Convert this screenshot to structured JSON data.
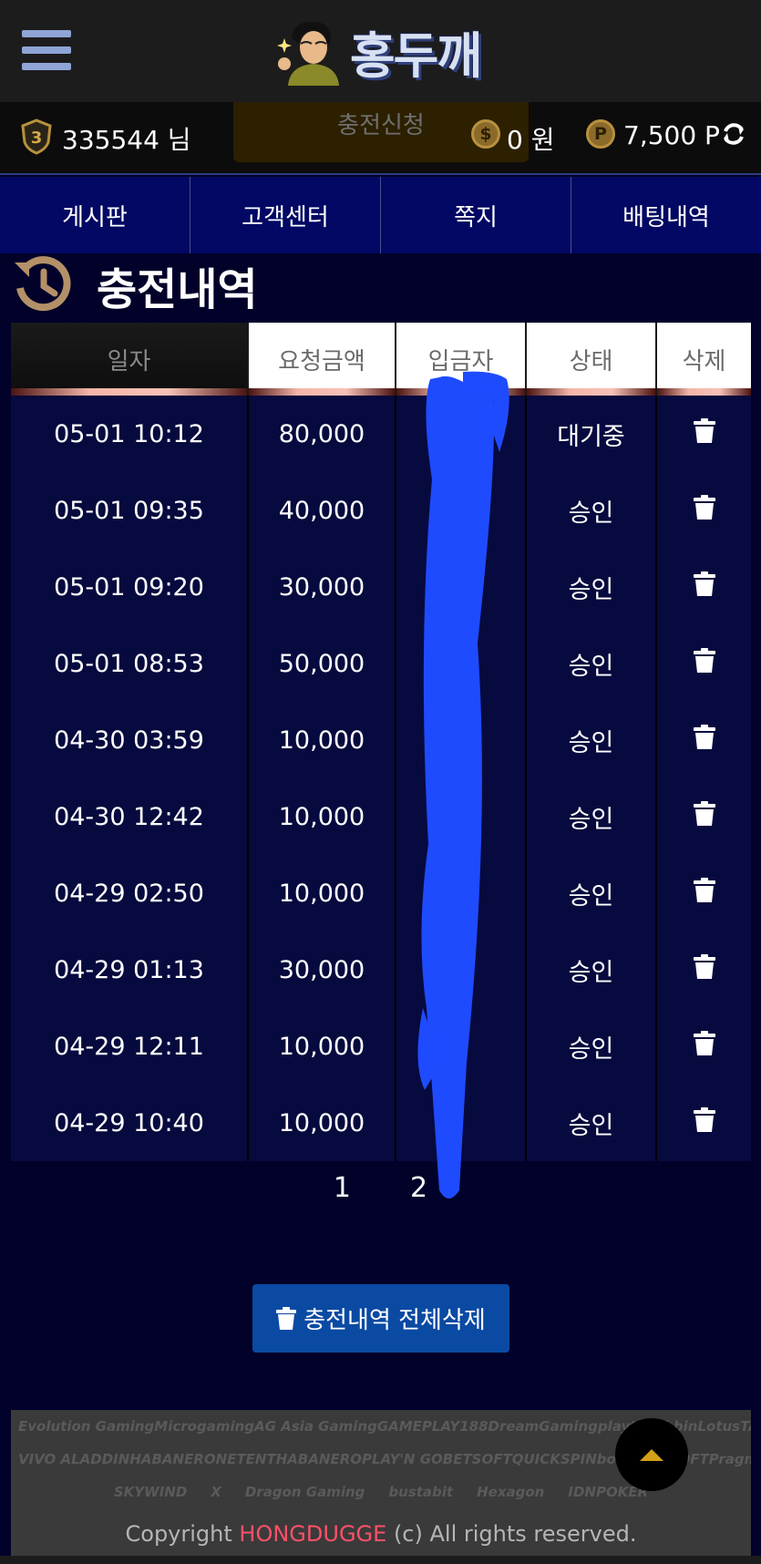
{
  "header": {
    "logo_text": "홍두깨"
  },
  "userbar": {
    "level": "3",
    "username": "335544 님",
    "charge_button": "충전신청",
    "money_symbol": "$",
    "money": "0 원",
    "point_symbol": "P",
    "points": "7,500 P"
  },
  "nav": [
    {
      "label": "게시판"
    },
    {
      "label": "고객센터"
    },
    {
      "label": "쪽지"
    },
    {
      "label": "배팅내역"
    }
  ],
  "page": {
    "title": "충전내역"
  },
  "table": {
    "headers": [
      "일자",
      "요청금액",
      "입금자",
      "상태",
      "삭제"
    ],
    "rows": [
      {
        "date": "05-01 10:12",
        "amount": "80,000",
        "depositor": "",
        "status": "대기중"
      },
      {
        "date": "05-01 09:35",
        "amount": "40,000",
        "depositor": "",
        "status": "승인"
      },
      {
        "date": "05-01 09:20",
        "amount": "30,000",
        "depositor": "",
        "status": "승인"
      },
      {
        "date": "05-01 08:53",
        "amount": "50,000",
        "depositor": "",
        "status": "승인"
      },
      {
        "date": "04-30 03:59",
        "amount": "10,000",
        "depositor": "",
        "status": "승인"
      },
      {
        "date": "04-30 12:42",
        "amount": "10,000",
        "depositor": "",
        "status": "승인"
      },
      {
        "date": "04-29 02:50",
        "amount": "10,000",
        "depositor": "",
        "status": "승인"
      },
      {
        "date": "04-29 01:13",
        "amount": "30,000",
        "depositor": "",
        "status": "승인"
      },
      {
        "date": "04-29 12:11",
        "amount": "10,000",
        "depositor": "",
        "status": "승인"
      },
      {
        "date": "04-29 10:40",
        "amount": "10,000",
        "depositor": "",
        "status": "승인"
      }
    ]
  },
  "pagination": {
    "pages": [
      "1",
      "2"
    ]
  },
  "delete_all_label": "충전내역 전체삭제",
  "footer": {
    "providers_row1": [
      "Evolution Gaming",
      "Microgaming",
      "AG Asia Gaming",
      "GAMEPLAY",
      "188",
      "DreamGaming",
      "playtech",
      "bbin",
      "Lotus",
      "TAISHAN"
    ],
    "providers_row2": [
      "VIVO ALADDIN",
      "HABANERO",
      "NETENT",
      "HABANERO",
      "PLAY'N GO",
      "BETSOFT",
      "QUICKSPIN",
      "booongo",
      "ISOFT",
      "Pragmatic"
    ],
    "providers_row3": [
      "SKYWIND",
      "X",
      "Dragon Gaming",
      "bustabit",
      "Hexagon",
      "IDNPOKER"
    ],
    "copyright_prefix": "Copyright ",
    "copyright_brand": "HONGDUGGE",
    "copyright_suffix": " (c) All rights reserved."
  },
  "colors": {
    "nav_bg": "#020863",
    "table_row_bg": "#070a3e",
    "delete_all_bg": "#0b4aa3",
    "brand_accent": "#ff5068",
    "redaction": "#1f4bff"
  },
  "icons": {
    "menu": "hamburger-menu-icon",
    "level": "shield-badge-icon",
    "refresh": "refresh-icon",
    "history": "history-clock-icon",
    "delete": "trash-icon",
    "scroll_top": "chevron-up-icon"
  }
}
